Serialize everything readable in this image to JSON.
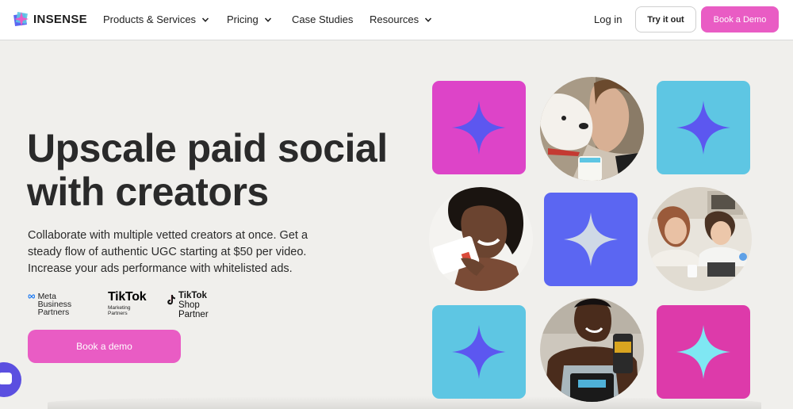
{
  "nav": {
    "brand": "INSENSE",
    "items": [
      "Products & Services",
      "Pricing",
      "Case Studies",
      "Resources"
    ],
    "login": "Log in",
    "try_label": "Try it out",
    "demo_label": "Book a Demo"
  },
  "hero": {
    "headline_line1": "Upscale paid social",
    "headline_line2": "with creators",
    "subtext": "Collaborate with multiple vetted creators at once. Get a steady flow of authentic UGC starting at $50 per video. Increase your ads performance with whitelisted ads.",
    "cta_label": "Book a demo"
  },
  "partners": {
    "meta_line1": "Meta Business",
    "meta_line2": "Partners",
    "tiktok_main": "TikTok",
    "tiktok_sub": "Marketing Partners",
    "shop_line1_bold": "TikTok",
    "shop_line1_rest": " Shop",
    "shop_line2": "Partner"
  },
  "icons": {
    "sparkle": "sparkle-icon",
    "chevron": "chevron-down-icon",
    "chat": "chat-icon"
  },
  "colors": {
    "accent_pink": "#e95cc4",
    "tile_magenta": "#dd44c8",
    "tile_cyan": "#5ec6e3",
    "tile_violet": "#5b66f2",
    "sparkle_violet": "#5c57f0",
    "sparkle_light": "#cfd9e6",
    "sparkle_cyan": "#7fe7f3",
    "chat_purple": "#5b4fe0"
  }
}
